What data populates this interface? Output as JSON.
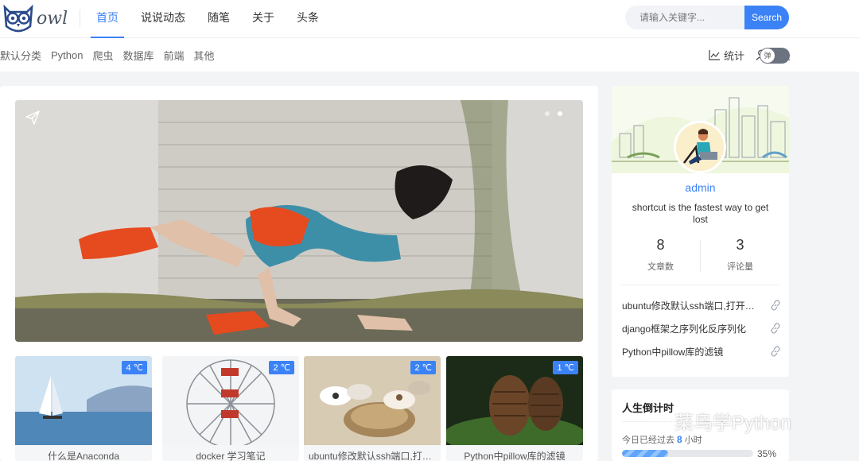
{
  "brand": {
    "name": "owl"
  },
  "nav": [
    "首页",
    "说说动态",
    "随笔",
    "关于",
    "头条"
  ],
  "search": {
    "placeholder": "请输入关键字...",
    "button": "Search"
  },
  "categories": [
    "默认分类",
    "Python",
    "爬虫",
    "数据库",
    "前端",
    "其他"
  ],
  "tools": {
    "stats": "统计",
    "login": "登录",
    "toggle": "弹"
  },
  "cards": [
    {
      "badge": "4 ℃",
      "title": "什么是Anaconda"
    },
    {
      "badge": "2 ℃",
      "title": "docker 学习笔记"
    },
    {
      "badge": "2 ℃",
      "title": "ubuntu修改默认ssh端口,打开防火墙"
    },
    {
      "badge": "1 ℃",
      "title": "Python中pillow库的滤镜"
    }
  ],
  "profile": {
    "name": "admin",
    "motto": "shortcut is the fastest way to get lost",
    "articles": {
      "value": "8",
      "label": "文章数"
    },
    "comments": {
      "value": "3",
      "label": "评论量"
    },
    "links": [
      "ubuntu修改默认ssh端口,打开防火墙",
      "django框架之序列化反序列化",
      "Python中pillow库的滤镜"
    ]
  },
  "countdown": {
    "title": "人生倒计时",
    "prefix": "今日已经过去",
    "hours": "8",
    "suffix": "小时",
    "percent_label": "35%",
    "percent": 35
  },
  "watermark": "菜鸟学Python",
  "colors": {
    "accent": "#3b82f6"
  }
}
